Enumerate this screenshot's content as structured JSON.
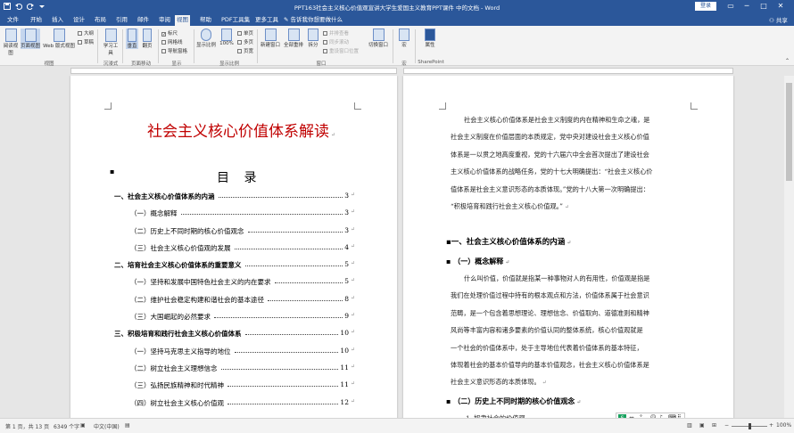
{
  "window": {
    "title": "PPT163社会主义核心价值观宣讲大学生爱国主义教育PPT课件 中的文档 - Word",
    "login": "登录",
    "share": "共享"
  },
  "tabs": [
    "文件",
    "开始",
    "插入",
    "设计",
    "布局",
    "引用",
    "邮件",
    "审阅",
    "视图",
    "帮助",
    "PDF工具集",
    "更多工具",
    "告诉我你想要做什么"
  ],
  "ribbon": {
    "views": {
      "read": "阅读视图",
      "print": "页面视图",
      "web": "Web 版式视图",
      "outline": "大纲",
      "draft": "草稿",
      "group": "视图"
    },
    "immersive": {
      "learn": "学习工具",
      "group": "沉浸式"
    },
    "page_move": {
      "vertical": "垂直",
      "side": "翻页",
      "group": "页面移动"
    },
    "show": {
      "ruler": "标尺",
      "grid": "网格线",
      "nav": "导航窗格",
      "group": "显示"
    },
    "zoom": {
      "zoom": "显示比例",
      "percent": "100%",
      "one": "单页",
      "multi": "多页",
      "width": "页宽",
      "group": "显示比例"
    },
    "window": {
      "new": "新建窗口",
      "arrange": "全部重排",
      "split": "拆分",
      "side": "并排查看",
      "sync": "同步滚动",
      "reset": "重设窗口位置",
      "switch": "切换窗口",
      "group": "窗口"
    },
    "macro": {
      "label": "宏",
      "group": "宏"
    },
    "sharepoint": {
      "label": "属性",
      "group": "SharePoint"
    }
  },
  "page1": {
    "title": "社会主义核心价值体系解读",
    "toc_heading": "目 录",
    "toc": [
      {
        "level": 1,
        "text": "一、社会主义核心价值体系的内涵",
        "page": "3"
      },
      {
        "level": 2,
        "text": "（一）概念解释",
        "page": "3"
      },
      {
        "level": 2,
        "text": "（二）历史上不同时期的核心价值观念",
        "page": "3"
      },
      {
        "level": 2,
        "text": "（三）社会主义核心价值观的发展",
        "page": "4"
      },
      {
        "level": 1,
        "text": "二、培育社会主义核心价值体系的重要意义",
        "page": "5"
      },
      {
        "level": 2,
        "text": "（一）坚持和发展中国特色社会主义的内在要求",
        "page": "5"
      },
      {
        "level": 2,
        "text": "（二）维护社会稳定构建和谐社会的基本途径",
        "page": "8"
      },
      {
        "level": 2,
        "text": "（三）大国崛起的必然要求",
        "page": "9"
      },
      {
        "level": 1,
        "text": "三、积极培育和践行社会主义核心价值体系",
        "page": "10"
      },
      {
        "level": 2,
        "text": "（一）坚持马克思主义指导的地位",
        "page": "10"
      },
      {
        "level": 2,
        "text": "（二）树立社会主义理想信念",
        "page": "11"
      },
      {
        "level": 2,
        "text": "（三）弘扬民族精神和时代精神",
        "page": "11"
      },
      {
        "level": 2,
        "text": "（四）树立社会主义核心价值观",
        "page": "12"
      }
    ]
  },
  "page2": {
    "intro": [
      "社会主义核心价值体系是社会主义制度的内在精神和生命之魂，是",
      "社会主义制度在价值层面的本质规定，党中央对建设社会主义核心价值",
      "体系是一以贯之地高度重视，党的十六届六中全会首次提出了建设社会",
      "主义核心价值体系的战略任务，党的十七大明确提出：“社会主义核心价",
      "值体系是社会主义意识形态的本质体现。”党的十八大第一次明确提出：",
      "“积极培育和践行社会主义核心价值观。”"
    ],
    "h1": "一、社会主义核心价值体系的内涵",
    "h2a": "（一）概念解释",
    "para2": [
      "什么叫价值，价值就是指某一种事物对人的有用性，价值观是指是",
      "我们在处理价值过程中持有的根本观点和方法，价值体系属于社会意识",
      "范畴，是一个包含着思想理论、理想信念、价值取向、道德准则和精神",
      "风尚等丰富内容和诸多要素的价值认同的整体系统，核心价值观就是",
      "一个社会的价值体系中，处于主导地位代表着价值体系的基本特征，",
      "体现着社会的基本价值导向的基本价值观念，社会主义核心价值体系是",
      "社会主义意识形态的本质体现。"
    ],
    "h2b": "（二）历史上不同时期的核心价值观念",
    "item1": "1. 奴隶社会的价值观"
  },
  "status": {
    "page": "第 1 页，共 13 页",
    "words": "6349 个字",
    "lang": "中文(中国)",
    "zoom": "100%"
  },
  "ime": {
    "label": "英"
  }
}
